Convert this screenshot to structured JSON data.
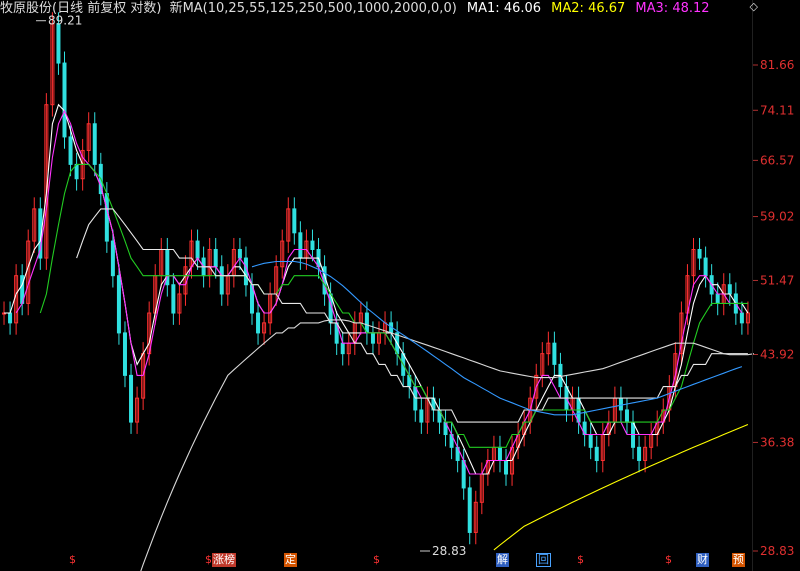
{
  "header": {
    "stock_label": "牧原股份(日线 前复权 对数)",
    "ma_label": "新MA(10,25,55,125,250,500,1000,2000,0,0)",
    "ma1_label": "MA1: 46.06",
    "ma2_label": "MA2: 46.67",
    "ma3_label": "MA3: 48.12",
    "diamond": "◇"
  },
  "chart_data": {
    "type": "line",
    "scale": "log",
    "y_ticks": [
      "81.66",
      "74.11",
      "66.57",
      "59.02",
      "51.47",
      "43.92",
      "36.38",
      "28.83"
    ],
    "y_tick_values": [
      81.66,
      74.11,
      66.57,
      59.02,
      51.47,
      43.92,
      36.38,
      28.83
    ],
    "ylim": [
      28.83,
      95
    ],
    "annotations": [
      {
        "label": "89.21",
        "value": 89.21,
        "bar_index": 8
      },
      {
        "label": "28.83",
        "value": 28.83,
        "bar_index": 95
      }
    ],
    "price_series": [
      {
        "name": "price",
        "color": "#ff3030",
        "values": [
          48,
          47,
          52,
          49,
          56,
          60,
          54,
          75,
          89.2,
          82,
          70,
          66,
          64,
          68,
          72,
          66,
          62,
          56,
          52,
          46,
          42,
          38,
          40,
          44,
          48,
          52,
          55,
          51,
          48,
          50,
          53,
          56,
          54,
          52,
          55,
          53,
          50,
          52,
          55,
          54,
          51,
          48,
          46,
          47,
          50,
          53,
          56,
          60,
          57,
          54,
          56,
          55,
          53,
          50,
          47,
          45,
          44,
          45,
          47,
          48,
          46,
          45,
          46,
          47,
          46,
          44,
          42,
          41,
          39,
          38,
          40,
          39,
          38,
          37,
          36,
          35,
          33,
          30,
          32,
          34,
          35,
          36,
          35,
          34,
          36,
          37,
          38,
          40,
          42,
          44,
          45,
          43,
          41,
          39,
          40,
          38,
          37,
          36,
          35,
          37,
          38,
          40,
          39,
          38,
          36,
          35,
          36,
          37,
          38,
          39,
          41,
          44,
          48,
          52,
          55,
          54,
          52,
          50,
          49,
          51,
          50,
          48,
          47,
          48
        ]
      },
      {
        "name": "",
        "color": "#ffffff",
        "values": [
          48,
          48,
          50,
          51,
          53,
          55,
          56,
          62,
          72,
          75,
          74,
          71,
          68,
          66,
          66,
          65,
          63,
          60,
          57,
          53,
          49,
          45,
          43,
          44,
          45,
          48,
          51,
          52,
          52,
          51,
          52,
          53,
          54,
          53,
          53,
          53,
          52,
          52,
          53,
          53,
          52,
          51,
          49,
          48,
          48,
          49,
          51,
          53,
          54,
          54,
          54,
          54,
          54,
          52,
          50,
          48,
          47,
          46,
          46,
          46,
          46,
          46,
          46,
          46,
          46,
          45,
          44,
          43,
          42,
          41,
          40,
          40,
          39,
          38,
          38,
          37,
          36,
          35,
          34,
          34,
          34,
          35,
          35,
          35,
          35,
          36,
          37,
          38,
          39,
          40,
          41,
          42,
          42,
          41,
          40,
          40,
          39,
          38,
          37,
          37,
          37,
          38,
          38,
          38,
          38,
          37,
          37,
          37,
          37,
          38,
          39,
          41,
          43,
          46,
          49,
          51,
          52,
          51,
          51,
          50,
          50,
          49,
          49,
          48
        ]
      },
      {
        "name": "",
        "color": "#ffff00",
        "values": [
          null,
          null,
          null,
          null,
          null,
          null,
          null,
          null,
          null,
          null,
          null,
          null,
          null,
          null,
          null,
          null,
          null,
          null,
          null,
          null,
          null,
          null,
          null,
          null,
          null,
          null,
          null,
          null,
          null,
          null,
          null,
          null,
          null,
          null,
          null,
          null,
          null,
          null,
          null,
          null,
          null,
          null,
          null,
          null,
          null,
          null,
          null,
          null,
          null,
          null,
          null,
          null,
          null,
          null,
          null,
          null,
          null,
          null,
          null,
          null,
          null,
          null,
          null,
          null,
          null,
          null,
          null,
          null,
          null,
          null,
          null,
          null,
          null,
          null,
          null,
          null,
          null,
          null,
          null,
          null,
          null,
          28.9,
          29.2,
          29.5,
          29.8,
          30.1,
          30.4,
          30.6,
          30.8,
          31,
          31.2,
          31.4,
          31.6,
          31.8,
          32,
          32.2,
          32.4,
          32.6,
          32.8,
          33,
          33.2,
          33.4,
          33.6,
          33.8,
          34,
          34.2,
          34.4,
          34.6,
          34.8,
          35,
          35.2,
          35.4,
          35.6,
          35.8,
          36,
          36.2,
          36.4,
          36.6,
          36.8,
          37,
          37.2,
          37.4,
          37.6,
          37.8
        ]
      },
      {
        "name": "",
        "color": "#ff33ff",
        "values": [
          null,
          null,
          48,
          49,
          51,
          53,
          55,
          60,
          67,
          72,
          74,
          72,
          69,
          67,
          66,
          65,
          63,
          60,
          57,
          53,
          49,
          45,
          42,
          42,
          44,
          47,
          50,
          52,
          52,
          51,
          51,
          53,
          54,
          53,
          53,
          53,
          52,
          52,
          53,
          54,
          53,
          51,
          49,
          48,
          48,
          49,
          51,
          54,
          55,
          55,
          55,
          54,
          53,
          51,
          49,
          47,
          45,
          45,
          45,
          46,
          46,
          46,
          46,
          46,
          45,
          44,
          43,
          42,
          41,
          40,
          40,
          39,
          39,
          38,
          37,
          36,
          35,
          34,
          34,
          34,
          35,
          35,
          35,
          35,
          36,
          37,
          38,
          39,
          41,
          42,
          42,
          41,
          40,
          40,
          39,
          38,
          37,
          37,
          37,
          37,
          38,
          38,
          38,
          37,
          37,
          37,
          37,
          37,
          38,
          38,
          40,
          42,
          45,
          48,
          51,
          52,
          52,
          51,
          50,
          50,
          49,
          49,
          48
        ]
      },
      {
        "name": "",
        "color": "#22cc22",
        "values": [
          null,
          null,
          null,
          null,
          null,
          null,
          48,
          50,
          54,
          58,
          62,
          65,
          66,
          66,
          66,
          65,
          64,
          62,
          60,
          58,
          56,
          54,
          53,
          52,
          52,
          52,
          52,
          52,
          52,
          52,
          52,
          52,
          52,
          52,
          52,
          52,
          52,
          52,
          52,
          52,
          52,
          51,
          51,
          50,
          50,
          50,
          51,
          51,
          52,
          52,
          52,
          52,
          52,
          51,
          50,
          49,
          48,
          48,
          47,
          47,
          46,
          46,
          46,
          46,
          45,
          44,
          43,
          42,
          41,
          41,
          40,
          39,
          39,
          38,
          38,
          37,
          37,
          36,
          36,
          36,
          36,
          36,
          36,
          36,
          37,
          37,
          38,
          38,
          39,
          39,
          39,
          39,
          39,
          39,
          39,
          39,
          39,
          38,
          38,
          38,
          38,
          38,
          38,
          38,
          38,
          38,
          38,
          38,
          38,
          39,
          39,
          40,
          41,
          43,
          45,
          47,
          48,
          49,
          49,
          49,
          49,
          49,
          49,
          49
        ]
      },
      {
        "name": "",
        "color": "#e8e8e8",
        "values": [
          null,
          null,
          null,
          null,
          null,
          null,
          null,
          null,
          null,
          null,
          null,
          null,
          54,
          56,
          58,
          59,
          60,
          60,
          60,
          59,
          58,
          57,
          56,
          55,
          55,
          55,
          55,
          55,
          55,
          54,
          54,
          54,
          53,
          53,
          53,
          52,
          52,
          52,
          52,
          52,
          52,
          51,
          51,
          50,
          50,
          50,
          49,
          49,
          49,
          49,
          48,
          48,
          48,
          48,
          47,
          47,
          46,
          46,
          45,
          45,
          44,
          44,
          43,
          43,
          42,
          42,
          41,
          41,
          40,
          40,
          40,
          39,
          39,
          39,
          39,
          38,
          38,
          38,
          38,
          38,
          38,
          38,
          38,
          38,
          38,
          38,
          39,
          39,
          39,
          39,
          40,
          40,
          40,
          40,
          40,
          40,
          40,
          40,
          40,
          40,
          40,
          40,
          40,
          40,
          40,
          40,
          40,
          40,
          40,
          41,
          41,
          41,
          42,
          42,
          43,
          43,
          43,
          44,
          44,
          44,
          44,
          44,
          44,
          44
        ]
      },
      {
        "name": "",
        "color": "#d8d8d8",
        "values": [
          null,
          null,
          null,
          null,
          null,
          null,
          null,
          null,
          null,
          null,
          null,
          null,
          null,
          null,
          null,
          null,
          null,
          null,
          null,
          null,
          null,
          26,
          27,
          28,
          29,
          30,
          31,
          32,
          33,
          34,
          35,
          36,
          37,
          38,
          39,
          40,
          41,
          42,
          42.5,
          43,
          43.5,
          44,
          44.5,
          45,
          45.5,
          46,
          46,
          46.5,
          46.5,
          47,
          47,
          47,
          47,
          47.2,
          47.3,
          47.3,
          47.3,
          47.2,
          47,
          47,
          46.8,
          46.6,
          46.4,
          46.2,
          46,
          45.8,
          45.6,
          45.4,
          45.2,
          45,
          44.8,
          44.6,
          44.4,
          44.2,
          44,
          43.8,
          43.6,
          43.4,
          43.2,
          43,
          42.8,
          42.6,
          42.4,
          42.3,
          42.2,
          42.1,
          42,
          41.9,
          41.8,
          41.8,
          41.8,
          41.8,
          41.9,
          42,
          42.1,
          42.2,
          42.3,
          42.4,
          42.5,
          42.6,
          42.8,
          43,
          43.2,
          43.4,
          43.6,
          43.8,
          44,
          44.2,
          44.4,
          44.6,
          44.8,
          45,
          45,
          45,
          45,
          44.8,
          44.6,
          44.4,
          44.2,
          44,
          43.9,
          43.9,
          43.9,
          43.9,
          44
        ]
      },
      {
        "name": "",
        "color": "#3399ff",
        "values": [
          null,
          null,
          null,
          null,
          null,
          null,
          null,
          null,
          null,
          null,
          null,
          null,
          null,
          null,
          null,
          null,
          null,
          null,
          null,
          null,
          null,
          null,
          null,
          null,
          null,
          null,
          null,
          null,
          null,
          null,
          null,
          null,
          null,
          null,
          null,
          null,
          null,
          null,
          null,
          null,
          null,
          53,
          53.2,
          53.4,
          53.5,
          53.6,
          53.6,
          53.6,
          53.6,
          53.5,
          53.3,
          53,
          52.7,
          52.3,
          51.9,
          51.4,
          50.9,
          50.3,
          49.7,
          49.1,
          48.5,
          48,
          47.5,
          47,
          46.6,
          46.2,
          45.8,
          45.4,
          45,
          44.6,
          44.2,
          43.8,
          43.4,
          43,
          42.6,
          42.2,
          41.8,
          41.5,
          41.2,
          40.9,
          40.6,
          40.3,
          40,
          39.8,
          39.6,
          39.4,
          39.2,
          39,
          38.9,
          38.8,
          38.7,
          38.6,
          38.6,
          38.6,
          38.6,
          38.7,
          38.8,
          38.9,
          39,
          39.1,
          39.2,
          39.3,
          39.4,
          39.5,
          39.6,
          39.7,
          39.8,
          39.9,
          40,
          40.2,
          40.4,
          40.6,
          40.8,
          41,
          41.2,
          41.4,
          41.6,
          41.8,
          42,
          42.2,
          42.4,
          42.6,
          42.8
        ]
      }
    ],
    "event_markers": [
      {
        "label": "$",
        "bar_index": 17
      },
      {
        "label": "涨榜",
        "bar_index": 53
      },
      {
        "label": "$",
        "bar_index": 51
      },
      {
        "label": "定",
        "bar_index": 71
      },
      {
        "label": "$",
        "bar_index": 93
      },
      {
        "label": "解",
        "bar_index": 124
      },
      {
        "label": "回",
        "bar_index": 134
      },
      {
        "label": "$",
        "bar_index": 144
      },
      {
        "label": "$",
        "bar_index": 166
      },
      {
        "label": "财",
        "bar_index": 174
      },
      {
        "label": "预",
        "bar_index": 183
      }
    ]
  }
}
